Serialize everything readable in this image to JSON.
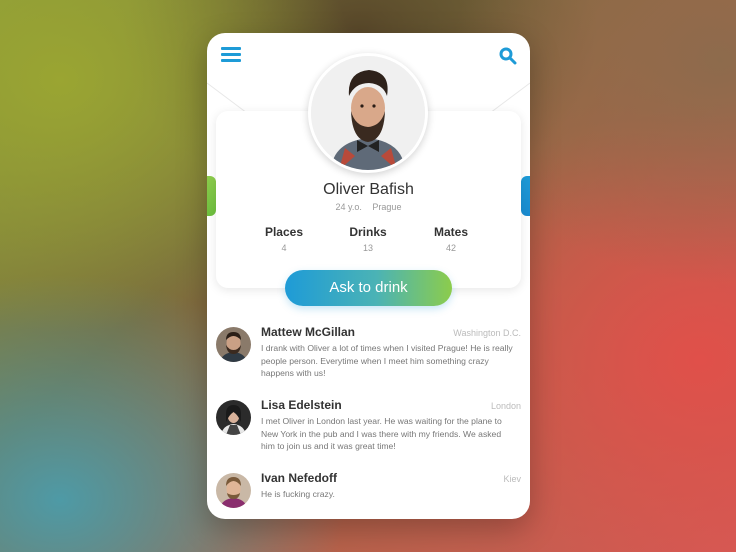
{
  "header": {
    "menu_icon": "hamburger-menu-icon",
    "search_icon": "search-icon",
    "accent": "#1e9bd7"
  },
  "profile": {
    "name": "Oliver Bafish",
    "age": "24 y.o.",
    "city": "Prague",
    "stats": [
      {
        "label": "Places",
        "value": "4"
      },
      {
        "label": "Drinks",
        "value": "13"
      },
      {
        "label": "Mates",
        "value": "42"
      }
    ],
    "cta_label": "Ask to drink"
  },
  "reviews": [
    {
      "name": "Mattew McGillan",
      "city": "Washington D.C.",
      "text": "I drank with Oliver a lot of times when I visited Prague! He is really people person. Everytime when I meet him something crazy happens with us!"
    },
    {
      "name": "Lisa Edelstein",
      "city": "London",
      "text": "I met Oliver in London last year. He was waiting for the plane to New York in the pub and I was there with my friends. We asked him to  join us and it was great time!"
    },
    {
      "name": "Ivan Nefedoff",
      "city": "Kiev",
      "text": "He is fucking crazy."
    }
  ],
  "colors": {
    "gradient_start": "#1e9bd7",
    "gradient_end": "#8ccc4c"
  }
}
